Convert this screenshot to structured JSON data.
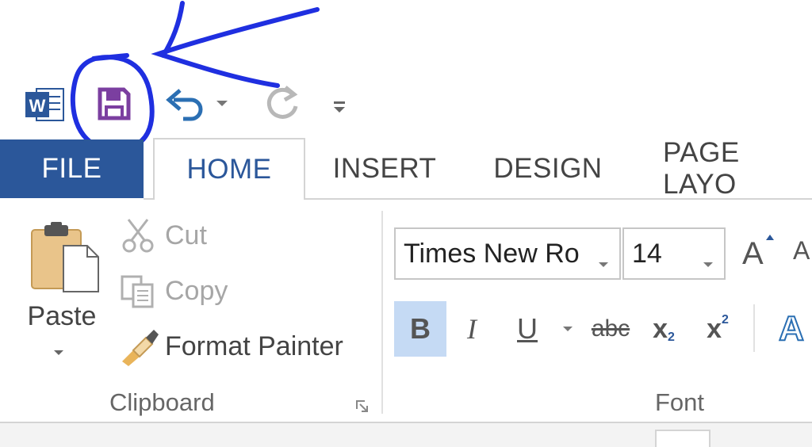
{
  "quick_access": {
    "app_icon": "word-icon",
    "save_icon": "save-icon",
    "undo_icon": "undo-icon",
    "redo_icon": "redo-icon",
    "customize_icon": "customize-toolbar-icon"
  },
  "tabs": [
    {
      "label": "FILE"
    },
    {
      "label": "HOME"
    },
    {
      "label": "INSERT"
    },
    {
      "label": "DESIGN"
    },
    {
      "label": "PAGE LAYO"
    }
  ],
  "clipboard": {
    "paste_label": "Paste",
    "cut_label": "Cut",
    "copy_label": "Copy",
    "format_painter_label": "Format Painter",
    "group_label": "Clipboard"
  },
  "font": {
    "font_name": "Times New Ro",
    "font_size": "14",
    "bold": "B",
    "italic": "I",
    "underline": "U",
    "strikethrough": "abc",
    "subscript_base": "x",
    "subscript_mark": "2",
    "superscript_base": "x",
    "superscript_mark": "2",
    "grow_font": "A",
    "text_effects": "A",
    "group_label": "Font"
  },
  "colors": {
    "accent": "#2b579a",
    "annotation": "#1f2fe0",
    "save_icon": "#7b3fa0",
    "bold_active_bg": "#c5daf4"
  }
}
